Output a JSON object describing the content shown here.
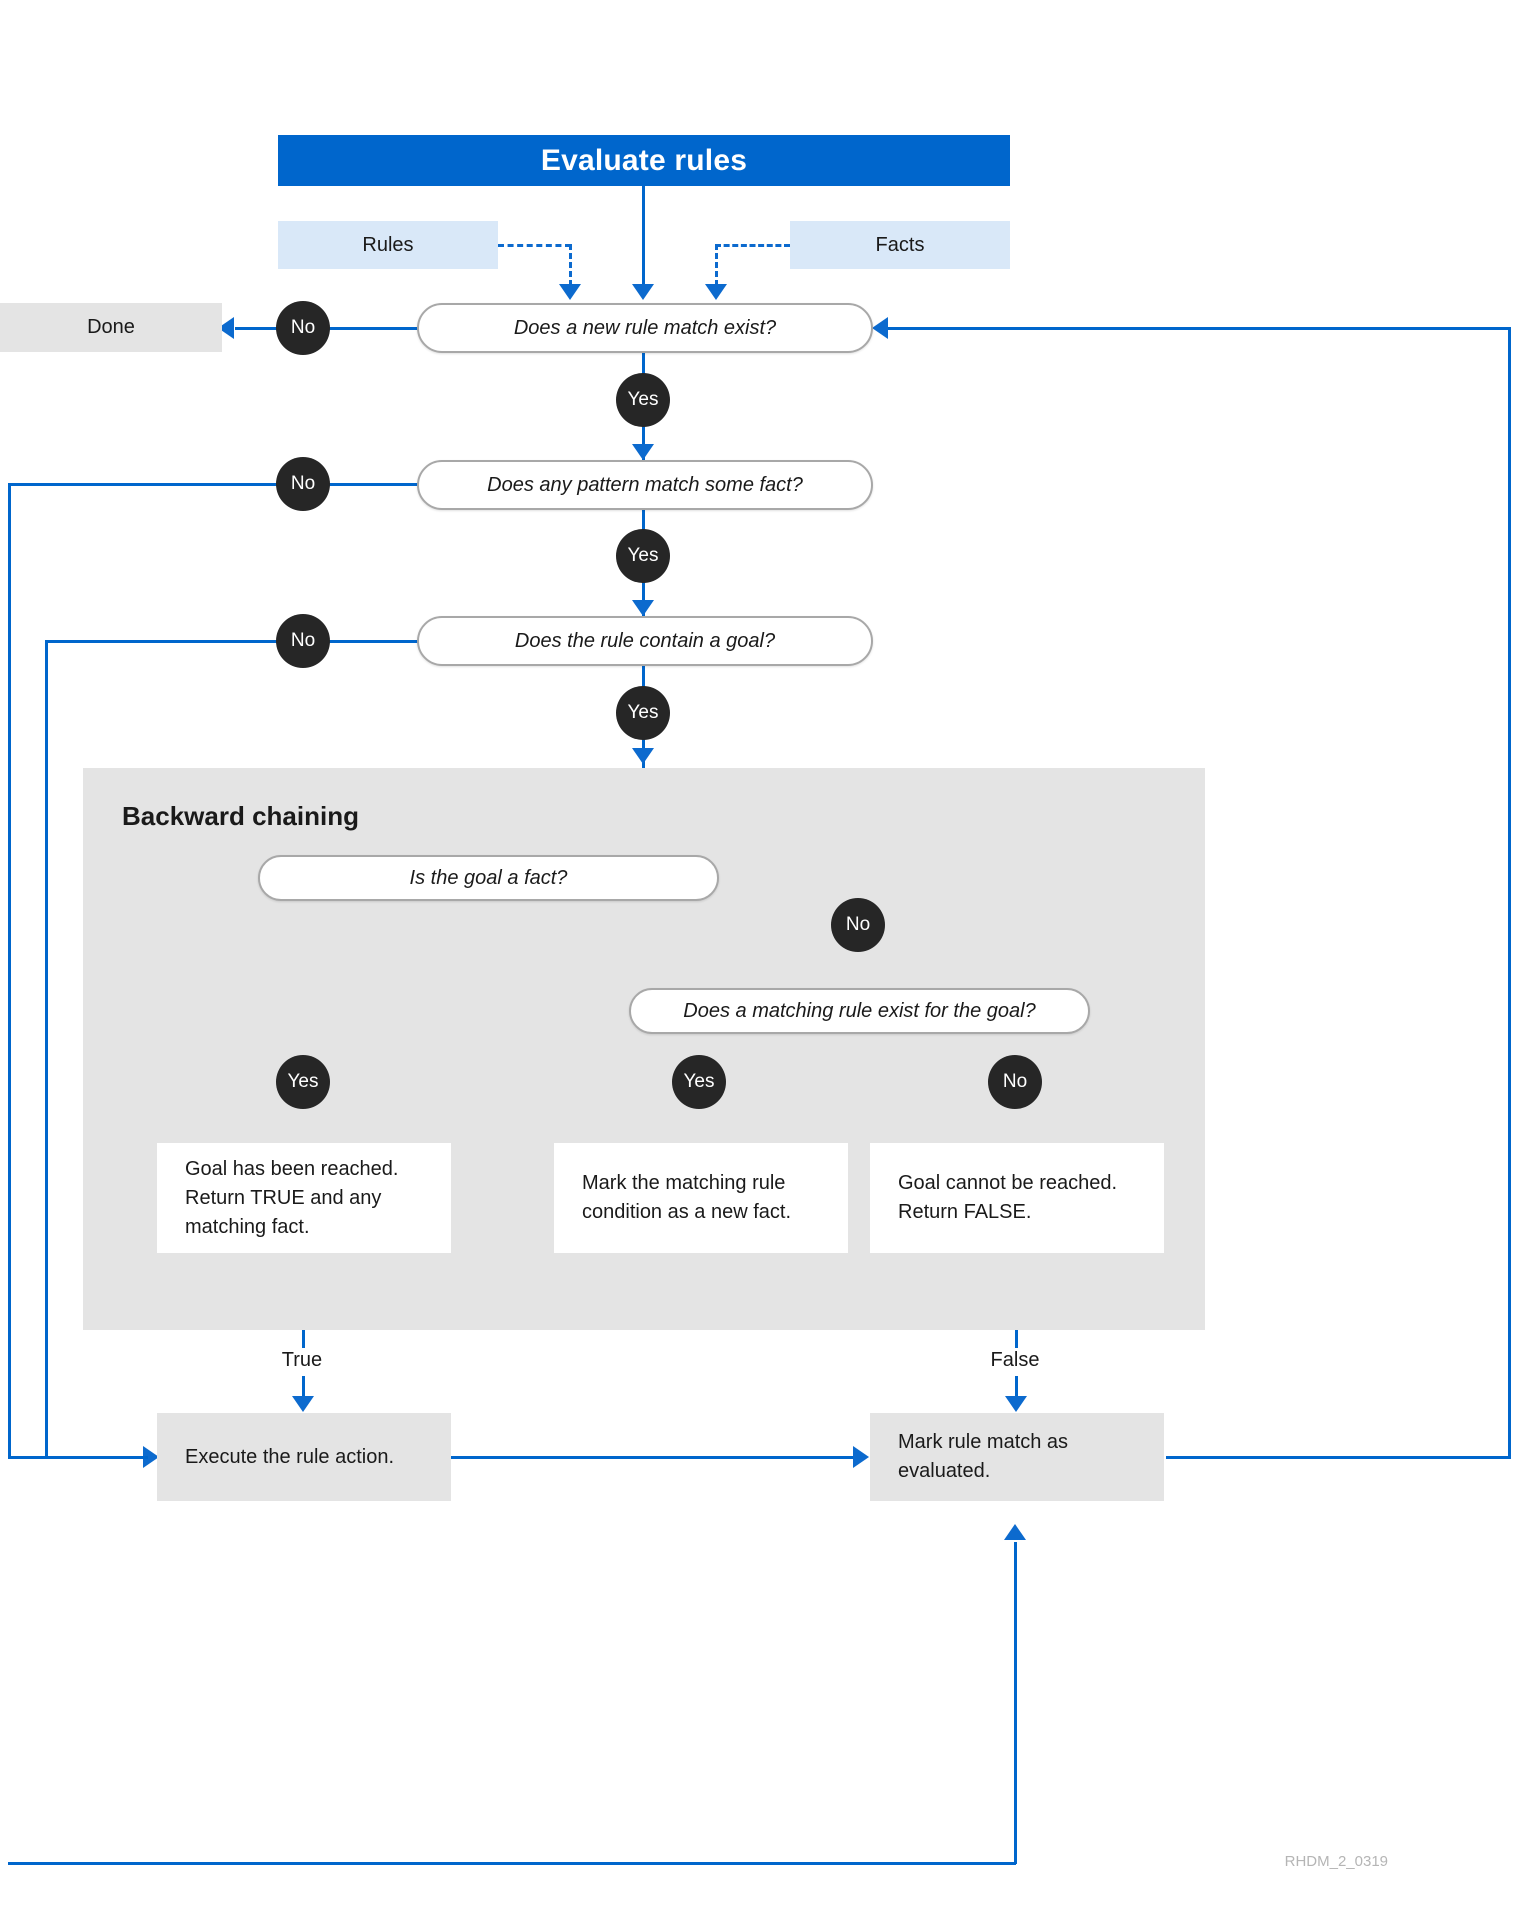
{
  "diagram": {
    "title": "Evaluate rules",
    "watermark": "RHDM_2_0319",
    "colors": {
      "banner": "#0066cc",
      "input_box": "#d9e8f8",
      "process_box": "#e4e4e4",
      "decision_border": "#a8a8a8",
      "connector": "#0066cc",
      "badge": "#262626"
    },
    "inputs": [
      {
        "label": "Rules"
      },
      {
        "label": "Facts"
      }
    ],
    "terminals": [
      {
        "label": "Done"
      }
    ],
    "decisions": [
      {
        "id": "d1",
        "label": "Does a new rule match exist?"
      },
      {
        "id": "d2",
        "label": "Does any pattern match some fact?"
      },
      {
        "id": "d3",
        "label": "Does the rule contain a goal?"
      },
      {
        "id": "d4",
        "label": "Is the goal a fact?"
      },
      {
        "id": "d5",
        "label": "Does a matching rule exist for the goal?"
      }
    ],
    "badges": {
      "d1_no": "No",
      "d1_yes": "Yes",
      "d2_no": "No",
      "d2_yes": "Yes",
      "d3_no": "No",
      "d3_yes": "Yes",
      "d4_yes": "Yes",
      "d4_no": "No",
      "d5_yes": "Yes",
      "d5_no": "No"
    },
    "panel": {
      "title": "Backward chaining",
      "results": [
        {
          "id": "r1",
          "text": "Goal has been reached. Return TRUE and any matching fact."
        },
        {
          "id": "r2",
          "text": "Mark the matching rule condition as a new fact."
        },
        {
          "id": "r3",
          "text": "Goal cannot be reached. Return FALSE."
        }
      ]
    },
    "outcome_labels": {
      "true": "True",
      "false": "False"
    },
    "actions": [
      {
        "id": "a1",
        "text": "Execute the rule action."
      },
      {
        "id": "a2",
        "text": "Mark rule match as evaluated."
      }
    ]
  }
}
